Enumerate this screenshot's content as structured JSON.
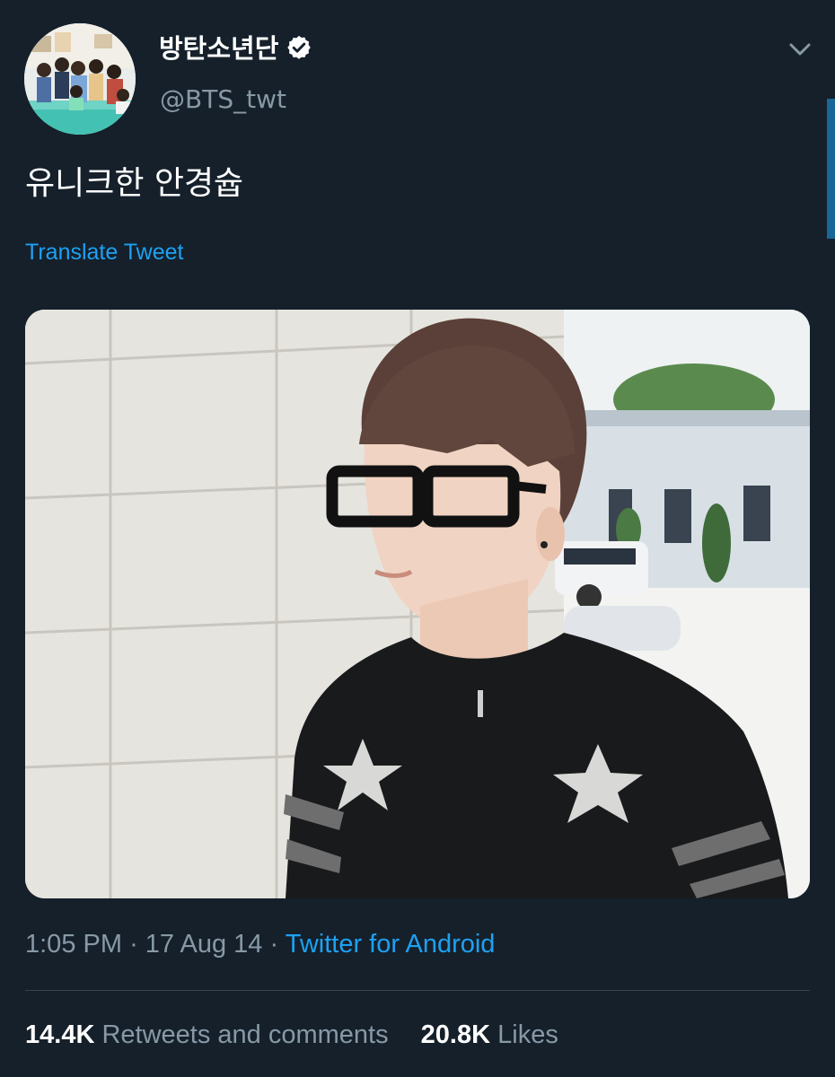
{
  "tweet": {
    "author": {
      "display_name": "방탄소년단",
      "handle": "@BTS_twt",
      "verified": true,
      "avatar_icon": "group-photo-avatar"
    },
    "text": "유니크한 안경슙",
    "translate_label": "Translate Tweet",
    "media": {
      "type": "photo",
      "icon": "photo-person-glasses"
    },
    "meta": {
      "time": "1:05 PM",
      "separator": "·",
      "date": "17 Aug 14",
      "source": "Twitter for Android"
    },
    "stats": {
      "retweets_count": "14.4K",
      "retweets_label": "Retweets and comments",
      "likes_count": "20.8K",
      "likes_label": "Likes"
    }
  },
  "colors": {
    "background": "#15202b",
    "text": "#ffffff",
    "secondary_text": "#8899a6",
    "accent": "#1da1f2",
    "divider": "#38444d"
  }
}
